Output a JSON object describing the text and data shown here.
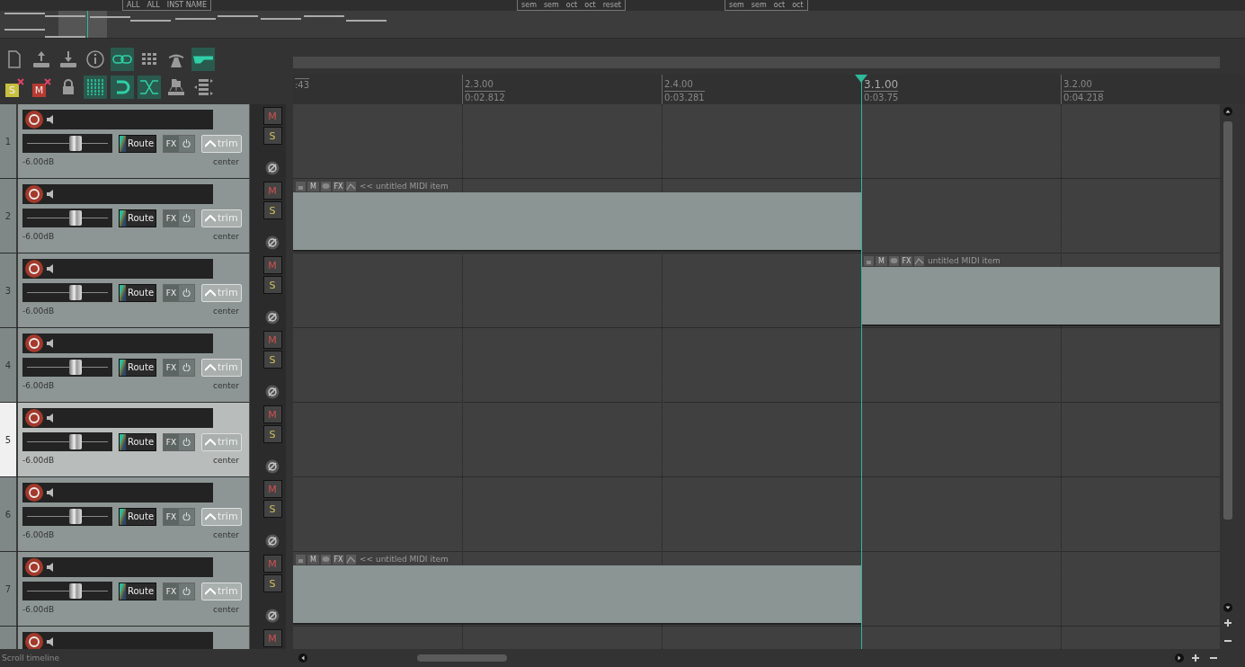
{
  "top_toolbar": {
    "labels": [
      "ALL",
      "ALL",
      "INST NAME"
    ],
    "pitch_buttons": [
      "sem",
      "sem",
      "oct",
      "oct",
      "reset"
    ],
    "pitch_buttons_2": [
      "sem",
      "sem",
      "oct",
      "oct"
    ]
  },
  "toolbar": {
    "rows": [
      [
        {
          "kind": "new-file",
          "on": false
        },
        {
          "kind": "upload",
          "on": false
        },
        {
          "kind": "download",
          "on": false
        },
        {
          "kind": "info",
          "on": false
        },
        {
          "kind": "link",
          "on": true
        },
        {
          "kind": "grid-dots",
          "on": false
        },
        {
          "kind": "cone",
          "on": false
        },
        {
          "kind": "envelope",
          "on": true
        }
      ],
      [
        {
          "kind": "clear",
          "label": "S",
          "color": "#c8c040",
          "on": false
        },
        {
          "kind": "clear",
          "label": "M",
          "color": "#b83a32",
          "on": false
        },
        {
          "kind": "lock",
          "on": false
        },
        {
          "kind": "grid-lines",
          "on": true
        },
        {
          "kind": "magnet",
          "on": true
        },
        {
          "kind": "crossfade",
          "on": true
        },
        {
          "kind": "folder-tree",
          "on": false
        },
        {
          "kind": "route-list",
          "on": false
        }
      ]
    ]
  },
  "ruler": {
    "cut_label": ":43",
    "markers": [
      {
        "bar": "2.3.00",
        "time": "0:02.812",
        "playhead": false
      },
      {
        "bar": "2.4.00",
        "time": "0:03.281",
        "playhead": false
      },
      {
        "bar": "3.1.00",
        "time": "0:03.75",
        "playhead": true
      },
      {
        "bar": "3.2.00",
        "time": "0:04.218",
        "playhead": false
      }
    ]
  },
  "tracks": [
    {
      "number": "1",
      "selected": false,
      "volume_fader": {
        "level": 0.6
      },
      "volume": "-6.00dB",
      "pan": "center",
      "route": "Route",
      "fx": "FX",
      "trim": "trim",
      "mute": "M",
      "solo": "S"
    },
    {
      "number": "2",
      "selected": false,
      "volume_fader": {
        "level": 0.6
      },
      "volume": "-6.00dB",
      "pan": "center",
      "route": "Route",
      "fx": "FX",
      "trim": "trim",
      "mute": "M",
      "solo": "S",
      "items": [
        {
          "name": "<< untitled MIDI item",
          "kind": "clipped",
          "badges": [
            "M",
            "FX"
          ]
        }
      ]
    },
    {
      "number": "3",
      "selected": false,
      "volume_fader": {
        "level": 0.6
      },
      "volume": "-6.00dB",
      "pan": "center",
      "route": "Route",
      "fx": "FX",
      "trim": "trim",
      "mute": "M",
      "solo": "S",
      "items": [
        {
          "name": "untitled MIDI item",
          "kind": "whole",
          "badges": [
            "M",
            "FX"
          ]
        }
      ]
    },
    {
      "number": "4",
      "selected": false,
      "volume_fader": {
        "level": 0.6
      },
      "volume": "-6.00dB",
      "pan": "center",
      "route": "Route",
      "fx": "FX",
      "trim": "trim",
      "mute": "M",
      "solo": "S"
    },
    {
      "number": "5",
      "selected": true,
      "volume_fader": {
        "level": 0.6
      },
      "volume": "-6.00dB",
      "pan": "center",
      "route": "Route",
      "fx": "FX",
      "trim": "trim",
      "mute": "M",
      "solo": "S"
    },
    {
      "number": "6",
      "selected": false,
      "volume_fader": {
        "level": 0.6
      },
      "volume": "-6.00dB",
      "pan": "center",
      "route": "Route",
      "fx": "FX",
      "trim": "trim",
      "mute": "M",
      "solo": "S"
    },
    {
      "number": "7",
      "selected": false,
      "volume_fader": {
        "level": 0.6
      },
      "volume": "-6.00dB",
      "pan": "center",
      "route": "Route",
      "fx": "FX",
      "trim": "trim",
      "mute": "M",
      "solo": "S",
      "items": [
        {
          "name": "<< untitled MIDI item",
          "kind": "clipped",
          "badges": [
            "M",
            "FX"
          ]
        }
      ]
    },
    {
      "selected": false,
      "mute": "M"
    }
  ],
  "status_bar": {
    "text": "Scroll timeline"
  }
}
